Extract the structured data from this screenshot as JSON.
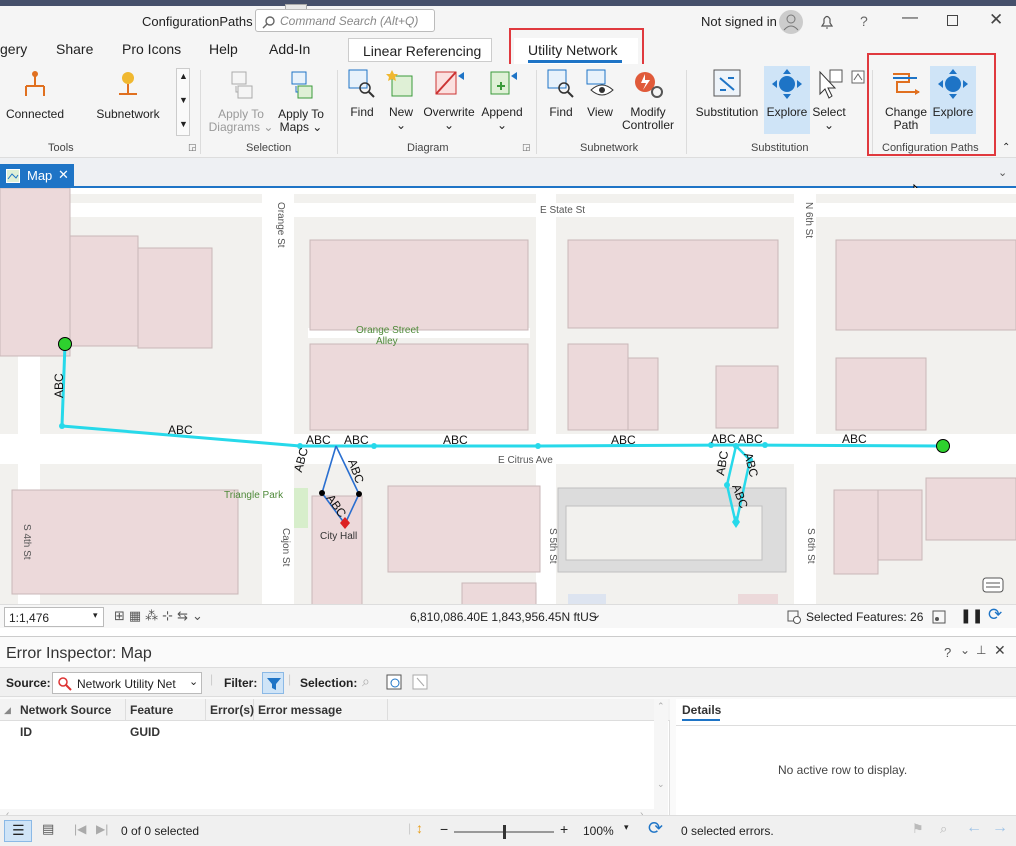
{
  "window": {
    "title": "ConfigurationPaths",
    "search_placeholder": "Command Search (Alt+Q)",
    "account": "Not signed in"
  },
  "ribbon_tabs": [
    "gery",
    "Share",
    "Pro Icons",
    "Help",
    "Add-In",
    "Linear Referencing",
    "Utility Network"
  ],
  "ribbon": {
    "tools": {
      "group": "Tools",
      "connected": "Connected",
      "subnetwork": "Subnetwork"
    },
    "selection": {
      "group": "Selection",
      "apply_diagrams": "Apply To",
      "apply_diagrams2": "Diagrams",
      "apply_maps": "Apply To",
      "apply_maps2": "Maps"
    },
    "diagram": {
      "group": "Diagram",
      "find": "Find",
      "new": "New",
      "overwrite": "Overwrite",
      "append": "Append"
    },
    "subnetwork": {
      "group": "Subnetwork",
      "find": "Find",
      "view": "View",
      "modify": "Modify",
      "modify2": "Controller"
    },
    "substitution": {
      "group": "Substitution",
      "substitution": "Substitution",
      "explore": "Explore",
      "select": "Select"
    },
    "config_paths": {
      "group": "Configuration Paths",
      "change": "Change",
      "change2": "Path",
      "explore": "Explore"
    }
  },
  "map_tab": {
    "label": "Map"
  },
  "map": {
    "streets": {
      "state": "E State St",
      "orange": "Orange St",
      "n6th": "N 6th St",
      "alley1": "Orange Street",
      "alley2": "Alley",
      "citrus": "E Citrus Ave",
      "s4th": "S 4th St",
      "cajon": "Cajon St",
      "s5th": "S 5th St",
      "s6th": "S 6th St"
    },
    "places": {
      "park": "Triangle Park",
      "cityhall": "City Hall"
    },
    "label": "ABC"
  },
  "map_status": {
    "scale": "1:1,476",
    "coords": "6,810,086.40E 1,843,956.45N ftUS",
    "selected": "Selected Features: 26"
  },
  "error_inspector": {
    "title": "Error Inspector: Map",
    "source_label": "Source:",
    "source_value": "Network Utility Net",
    "filter_label": "Filter:",
    "selection_label": "Selection:",
    "columns": [
      "Network Source ID",
      "Feature GUID",
      "Error(s)",
      "Error message"
    ],
    "details_tab": "Details",
    "no_row": "No active row to display.",
    "count": "0 of 0 selected",
    "zoom": "100%",
    "selected_errors": "0 selected errors."
  }
}
